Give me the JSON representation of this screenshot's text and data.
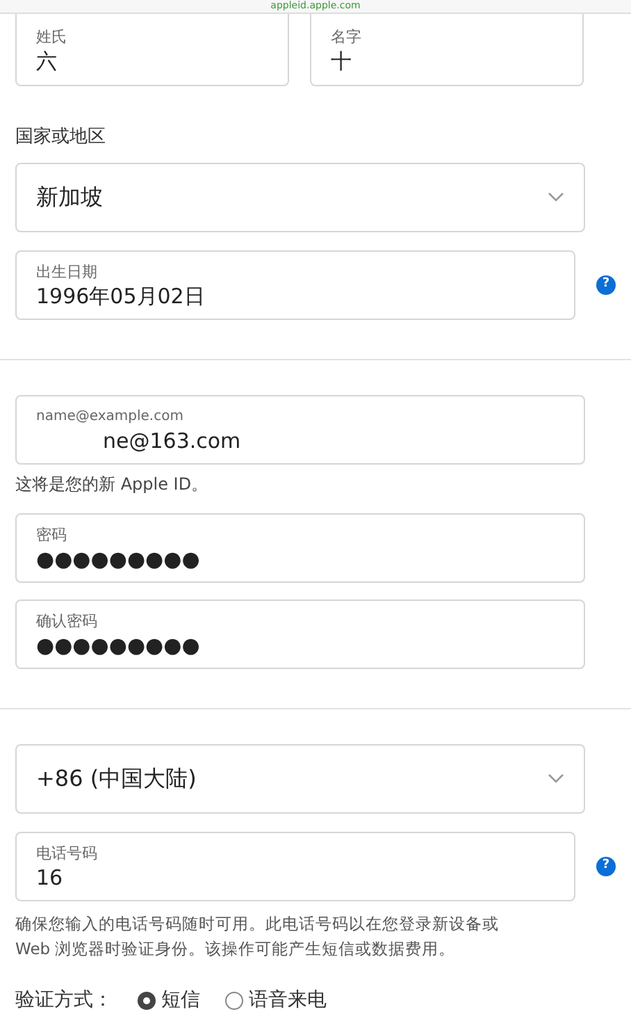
{
  "address_bar": {
    "url": "appleid.apple.com"
  },
  "name_fields": [
    {
      "label": "姓氏",
      "value": "六"
    },
    {
      "label": "名字",
      "value": "十"
    }
  ],
  "country": {
    "label": "国家或地区",
    "value": "新加坡"
  },
  "birth_date": {
    "label": "出生日期",
    "value": "1996年05月02日",
    "help": "?"
  },
  "email": {
    "placeholder": "name@example.com",
    "value": "ne@163.com",
    "note": "这将是您的新 Apple ID。"
  },
  "password_fields": [
    {
      "label": "密码",
      "value": "●●●●●●●●●"
    },
    {
      "label": "确认密码",
      "value": "●●●●●●●●●"
    }
  ],
  "phone_code": {
    "value": "+86 (中国大陆)"
  },
  "phone": {
    "label": "电话号码",
    "value": "16",
    "help": "?",
    "note": "确保您输入的电话号码随时可用。此电话号码以在您登录新设备或 Web 浏览器时验证身份。该操作可能产生短信或数据费用。"
  },
  "verification": {
    "label": "验证方式：",
    "options": [
      {
        "label": "短信",
        "selected": true
      },
      {
        "label": "语音来电",
        "selected": false
      }
    ]
  }
}
